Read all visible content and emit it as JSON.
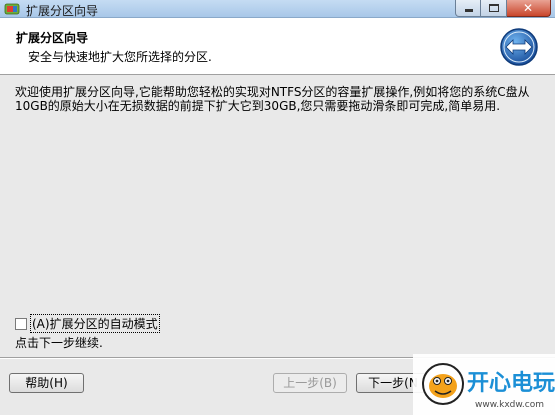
{
  "window": {
    "title": "扩展分区向导",
    "close_glyph": "✕"
  },
  "header": {
    "title": "扩展分区向导",
    "subtitle": "安全与快速地扩大您所选择的分区."
  },
  "description": "欢迎使用扩展分区向导,它能帮助您轻松的实现对NTFS分区的容量扩展操作,例如将您的系统C盘从10GB的原始大小在无损数据的前提下扩大它到30GB,您只需要拖动滑条即可完成,简单易用.",
  "auto_mode": {
    "label": "(A)扩展分区的自动模式",
    "checked": false
  },
  "continue_hint": "点击下一步继续.",
  "buttons": {
    "help": "帮助(H)",
    "prev": "上一步(B)",
    "next": "下一步(N"
  },
  "watermark": {
    "text": "开心电玩",
    "url": "www.kxdw.com"
  },
  "icons": {
    "app": "partition-app-icon",
    "header": "resize-arrows-icon"
  },
  "colors": {
    "header_bg": "#ffffff",
    "body_bg": "#e9e9e9",
    "titlebar": "#b8d1ec",
    "close": "#c9452b",
    "watermark": "#1b8fd6"
  }
}
